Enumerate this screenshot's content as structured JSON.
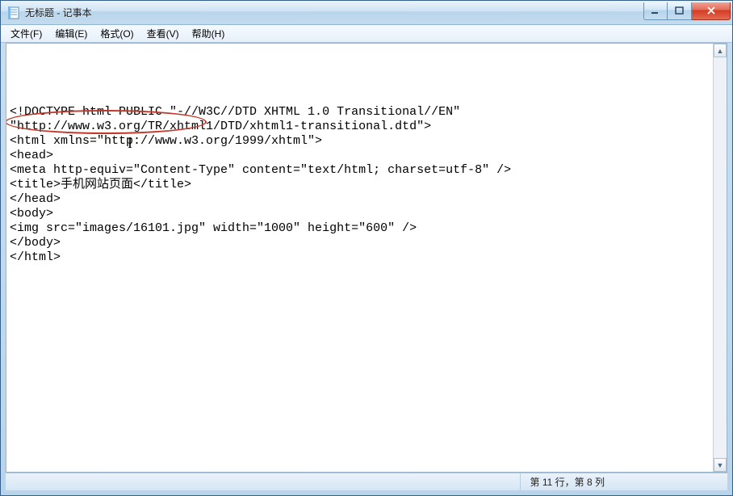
{
  "window": {
    "title": "无标题 - 记事本"
  },
  "menubar": {
    "file": "文件(F)",
    "edit": "编辑(E)",
    "format": "格式(O)",
    "view": "查看(V)",
    "help": "帮助(H)"
  },
  "editor": {
    "lines": [
      "<!DOCTYPE html PUBLIC \"-//W3C//DTD XHTML 1.0 Transitional//EN\"",
      "\"http://www.w3.org/TR/xhtml1/DTD/xhtml1-transitional.dtd\">",
      "<html xmlns=\"http://www.w3.org/1999/xhtml\">",
      "<head>",
      "<meta http-equiv=\"Content-Type\" content=\"text/html; charset=utf-8\" />",
      "<title>手机网站页面</title>",
      "</head>",
      "<body>",
      "<img src=\"images/16101.jpg\" width=\"1000\" height=\"600\" />",
      "</body>",
      "</html>"
    ]
  },
  "statusbar": {
    "position": "第 11 行，第 8 列"
  },
  "annotation": {
    "color": "#c0392b"
  }
}
